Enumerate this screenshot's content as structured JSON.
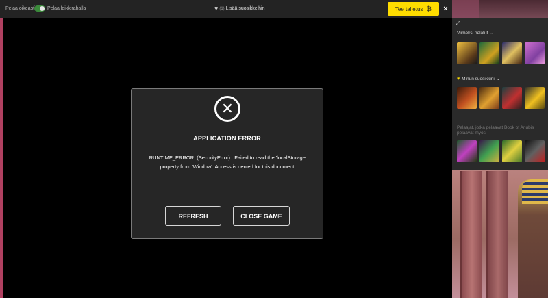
{
  "topbar": {
    "play_mode_label": "Pelaa oikeasti",
    "practice_label": "Pelaa leikkirahalla",
    "favorites_count": "(1)",
    "add_favorites_label": "Lisää suosikkeihin",
    "deposit_label": "Tee talletus",
    "close_label": "×"
  },
  "dialog": {
    "title": "APPLICATION ERROR",
    "message": "RUNTIME_ERROR: (SecurityError) : Failed to read the 'localStorage' property from 'Window': Access is denied for this document.",
    "refresh_label": "REFRESH",
    "close_game_label": "CLOSE GAME"
  },
  "panel": {
    "recent_label": "Viimeksi pelatut",
    "favorites_label": "Minun suosikkini",
    "recommend_label": "Pelaajat, jotka pelaavat Book of Anubis pelaavat myös",
    "recent_games": [
      "game-1",
      "game-2",
      "game-3",
      "game-4"
    ],
    "favorite_games": [
      "game-5",
      "game-6",
      "game-7",
      "game-8"
    ],
    "recommended_games": [
      "game-9",
      "game-10",
      "game-11",
      "game-12"
    ]
  },
  "colors": {
    "deposit_yellow": "#ffdd00",
    "toggle_green": "#3b8a3b",
    "topbar_bg": "#232323",
    "dialog_bg": "#262626"
  }
}
